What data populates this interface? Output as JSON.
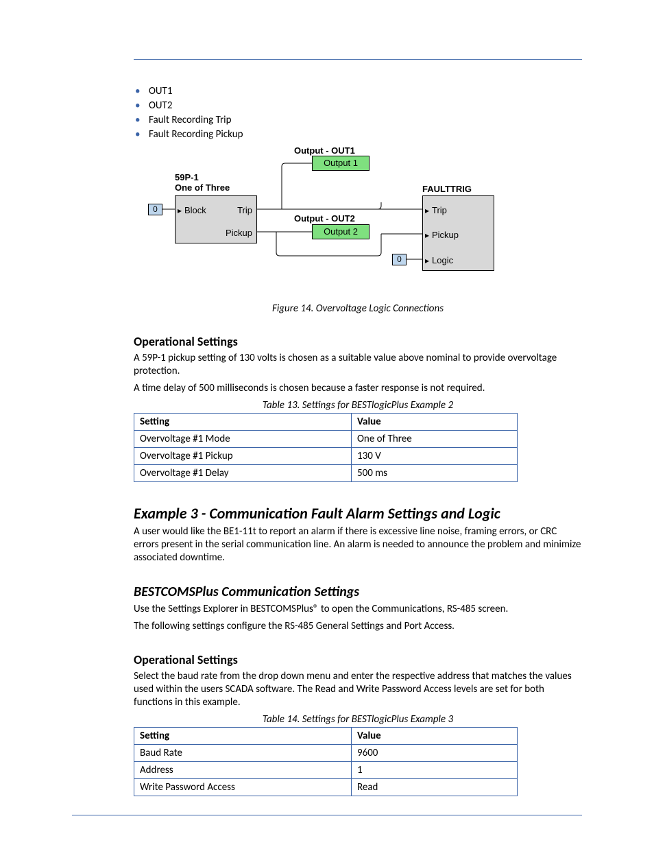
{
  "bullets": [
    "OUT1",
    "OUT2",
    "Fault Recording Trip",
    "Fault Recording Pickup"
  ],
  "diagram": {
    "block59_title1": "59P-1",
    "block59_title2": "One of Three",
    "block59_port_block": "Block",
    "block59_port_trip": "Trip",
    "block59_port_pickup": "Pickup",
    "out1_title": "Output - OUT1",
    "out1_label": "Output 1",
    "out2_title": "Output - OUT2",
    "out2_label": "Output 2",
    "fault_title": "FAULTTRIG",
    "fault_trip": "Trip",
    "fault_pickup": "Pickup",
    "fault_logic": "Logic",
    "zero": "0"
  },
  "fig14_caption": "Figure 14. Overvoltage Logic Connections",
  "sec1_h": "Operational Settings",
  "sec1_p1": "A 59P-1 pickup setting of 130 volts is chosen as a suitable value above nominal to provide overvoltage protection.",
  "sec1_p2": "A time delay of 500 milliseconds is chosen because a faster response is not required.",
  "t13cap": "Table 13. Settings for BESTlogicPlus Example 2",
  "t13": {
    "h1": "Setting",
    "h2": "Value",
    "r1c1": "Overvoltage #1 Mode",
    "r1c2": "One of Three",
    "r2c1": "Overvoltage #1 Pickup",
    "r2c2": "130 V",
    "r3c1": "Overvoltage #1 Delay",
    "r3c2": "500 ms"
  },
  "ex3_h": "Example 3 - Communication Fault Alarm Settings and Logic",
  "ex3_p": "A user would like the BE1-11t to report an alarm if there is excessive line noise, framing errors, or CRC errors present in the serial communication line. An alarm is needed to announce the problem and minimize associated downtime.",
  "cu_h": "BESTCOMSPlus Communication Settings",
  "cu_p1": "Use the Settings Explorer in BESTCOMSPlus® to open the Communications, RS-485 screen.",
  "cu_p2": "The following settings configure the RS-485 General Settings and Port Access.",
  "op_h": "Operational Settings",
  "op_p": "Select the baud rate from the drop down menu and enter the respective address that matches the values used within the users SCADA software. The Read and Write Password Access levels are set for both functions in this example.",
  "t14cap": "Table 14. Settings for BESTlogicPlus Example 3",
  "t14": {
    "h1": "Setting",
    "h2": "Value",
    "r1c1": "Baud Rate",
    "r1c2": "9600",
    "r2c1": "Address",
    "r2c2": "1",
    "r3c1": "Write Password Access",
    "r3c2": "Read"
  }
}
